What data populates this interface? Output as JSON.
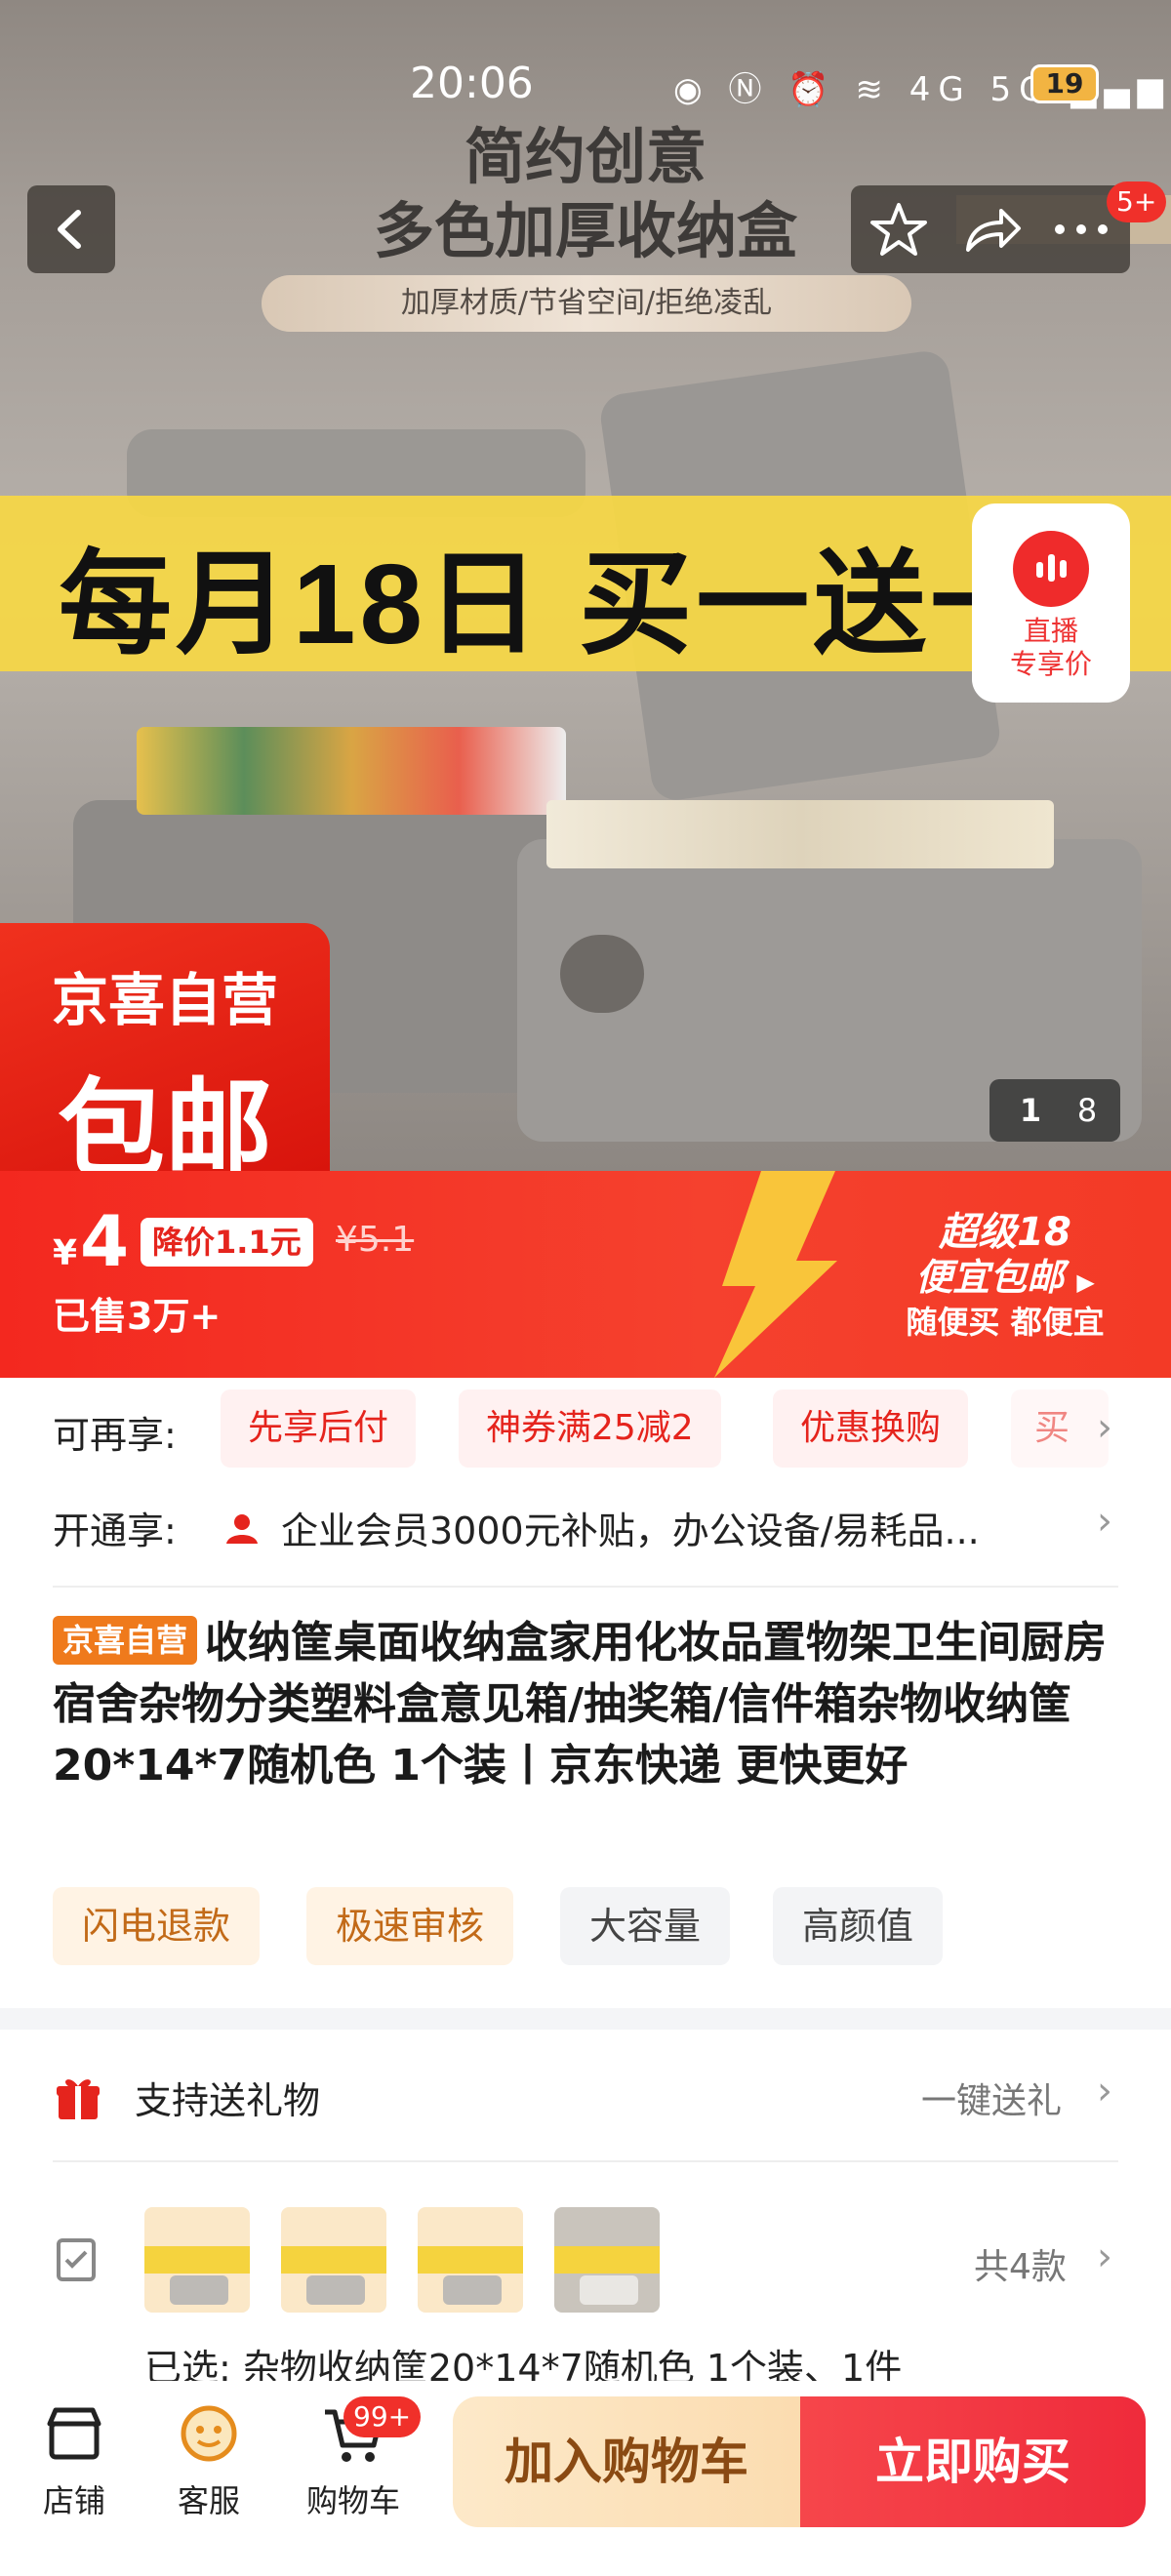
{
  "status_bar": {
    "time": "20:06",
    "network": "4G 5G",
    "battery": "19"
  },
  "hero": {
    "headline_1": "简约创意",
    "headline_2": "多色加厚收纳盒",
    "subline": "加厚材质/节省空间/拒绝凌乱",
    "banner": "每月18日 买一送一",
    "badge_top": "京喜自营",
    "badge_bottom": "包邮",
    "live_label_1": "直播",
    "live_label_2": "专享价",
    "page_current": "1",
    "page_total": "8",
    "notif_count": "5+"
  },
  "price": {
    "currency": "¥",
    "amount": "4",
    "discount": "降价1.1元",
    "original": "¥5.1",
    "sold": "已售3万+",
    "promo_title": "超级18",
    "promo_line2": "便宜包邮",
    "promo_line3": "随便买 都便宜"
  },
  "offers": {
    "label": "可再享:",
    "chips": [
      "先享后付",
      "神券满25减2",
      "优惠换购",
      "买"
    ]
  },
  "membership": {
    "label": "开通享:",
    "text": "企业会员3000元补贴，办公设备/易耗品..."
  },
  "product": {
    "shop_tag": "京喜自营",
    "title": "收纳筐桌面收纳盒家用化妆品置物架卫生间厨房宿舍杂物分类塑料盒意见箱/抽奖箱/信件箱杂物收纳筐20*14*7随机色 1个装丨京东快递 更快更好",
    "tags": [
      "闪电退款",
      "极速审核",
      "大容量",
      "高颜值"
    ]
  },
  "gift": {
    "label": "支持送礼物",
    "action": "一键送礼"
  },
  "variants": {
    "count": "共4款",
    "selected": "已选:  杂物收纳筐20*14*7随机色 1个装、1件"
  },
  "bottom_bar": {
    "store": "店铺",
    "service": "客服",
    "cart": "购物车",
    "cart_badge": "99+",
    "add_to_cart": "加入购物车",
    "buy_now": "立即购买"
  },
  "colors": {
    "accent_red": "#f33a26",
    "banner_yellow": "#f6d745",
    "tag_orange": "#ef7a1c"
  }
}
